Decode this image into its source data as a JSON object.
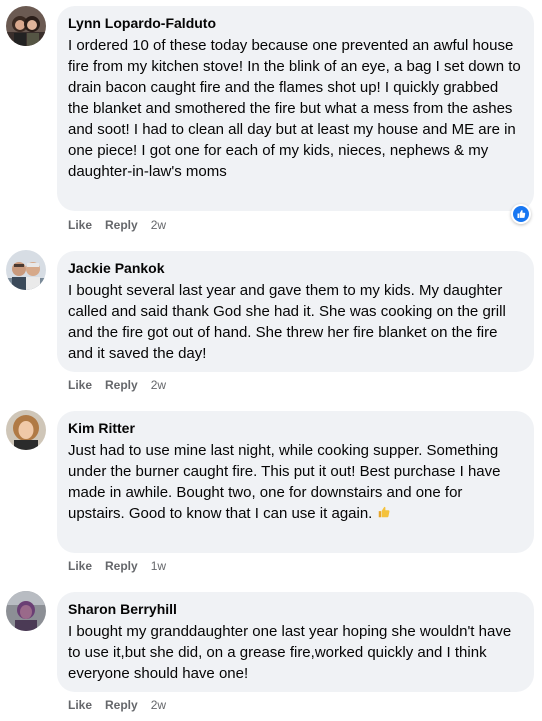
{
  "comments": [
    {
      "author": "Lynn Lopardo-Falduto",
      "text": "I ordered 10 of these today because one prevented an awful house fire from my kitchen stove! In the blink of an eye, a bag I set down to drain bacon caught fire and the flames shot up! I quickly grabbed the blanket and smothered the fire but what a mess from the ashes and soot! I had to clean all day but at least my house and ME are in one piece! I got one for each of my kids, nieces, nephews & my daughter-in-law's moms",
      "like": "Like",
      "reply": "Reply",
      "time": "2w",
      "reaction": "like-icon"
    },
    {
      "author": "Jackie Pankok",
      "text": "I bought several last year and gave them to my kids. My daughter called and said thank God she had it. She was cooking on the grill and the fire got out of hand. She threw her fire blanket on the fire and it saved the day!",
      "like": "Like",
      "reply": "Reply",
      "time": "2w"
    },
    {
      "author": "Kim Ritter",
      "text": "Just had to use mine last night, while cooking supper. Something under the burner caught fire. This put it out! Best purchase I have made in awhile. Bought two, one for downstairs and one for upstairs. Good to know that I can use it again.",
      "emoji": "thumbs-up-icon",
      "like": "Like",
      "reply": "Reply",
      "time": "1w"
    },
    {
      "author": "Sharon Berryhill",
      "text": "I bought my granddaughter one last year hoping she wouldn't have to use it,but she did, on a grease fire,worked quickly and I think everyone should have one!",
      "like": "Like",
      "reply": "Reply",
      "time": "2w"
    }
  ],
  "colors": {
    "bubble": "#f0f2f5",
    "text": "#050505",
    "meta": "#65676b",
    "like_blue": "#1877f2"
  }
}
